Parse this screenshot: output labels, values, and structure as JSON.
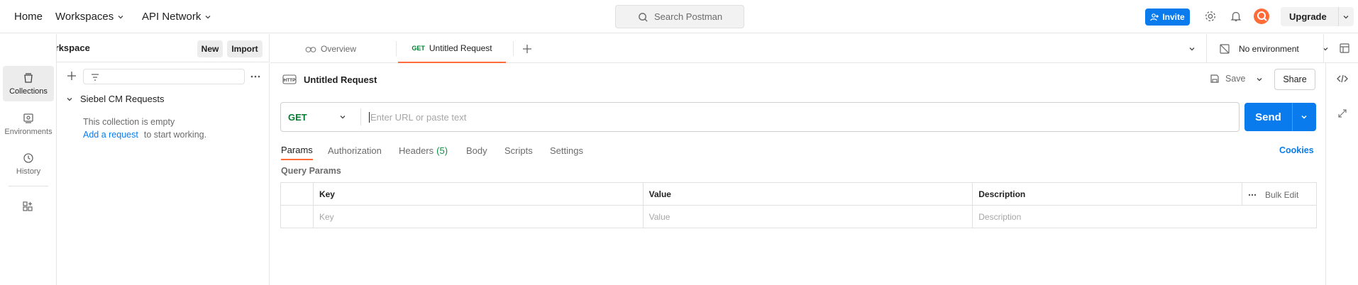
{
  "topbar": {
    "home": "Home",
    "workspaces": "Workspaces",
    "api_network": "API Network",
    "search_placeholder": "Search Postman",
    "invite": "Invite",
    "upgrade": "Upgrade"
  },
  "workspace": {
    "name": "My Workspace",
    "new_label": "New",
    "import_label": "Import"
  },
  "rail": {
    "items": [
      {
        "label": "Collections",
        "icon": "collections-icon",
        "active": true
      },
      {
        "label": "Environments",
        "icon": "environments-icon",
        "active": false
      },
      {
        "label": "History",
        "icon": "history-icon",
        "active": false
      }
    ]
  },
  "sidebar": {
    "collection_name": "Siebel CM Requests",
    "empty_text": "This collection is empty",
    "add_request": "Add a request",
    "to_start": "to start working."
  },
  "tabs": {
    "overview": "Overview",
    "active_method": "GET",
    "active_title": "Untitled Request",
    "environment": "No environment"
  },
  "request": {
    "title": "Untitled Request",
    "save": "Save",
    "share": "Share",
    "method": "GET",
    "url_placeholder": "Enter URL or paste text",
    "send": "Send",
    "tabs": {
      "params": "Params",
      "authorization": "Authorization",
      "headers": "Headers",
      "headers_count": "(5)",
      "body": "Body",
      "scripts": "Scripts",
      "settings": "Settings"
    },
    "cookies": "Cookies",
    "query_params_title": "Query Params",
    "table": {
      "headers": {
        "key": "Key",
        "value": "Value",
        "description": "Description",
        "bulk_edit": "Bulk Edit"
      },
      "placeholders": {
        "key": "Key",
        "value": "Value",
        "description": "Description"
      }
    }
  },
  "colors": {
    "accent_blue": "#097bed",
    "active_tab_orange": "#ff6c37",
    "get_green": "#007f31",
    "headers_count_green": "#0c8f43"
  }
}
